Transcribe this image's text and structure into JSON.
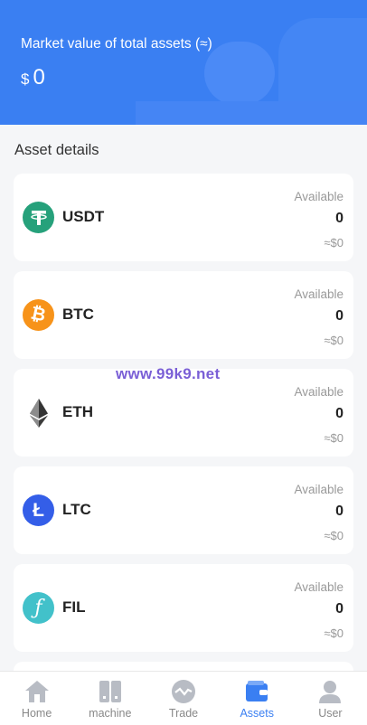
{
  "header": {
    "title": "Market value of total assets (≈)",
    "currency": "$",
    "total": "0"
  },
  "section_title": "Asset details",
  "assets": [
    {
      "symbol": "USDT",
      "available_label": "Available",
      "available": "0",
      "approx": "≈$0",
      "icon": "usdt-icon",
      "color": "#26a17b",
      "glyph": "₮"
    },
    {
      "symbol": "BTC",
      "available_label": "Available",
      "available": "0",
      "approx": "≈$0",
      "icon": "btc-icon",
      "color": "#f7931a",
      "glyph": "₿"
    },
    {
      "symbol": "ETH",
      "available_label": "Available",
      "available": "0",
      "approx": "≈$0",
      "icon": "eth-icon",
      "color": "#ffffff",
      "glyph": ""
    },
    {
      "symbol": "LTC",
      "available_label": "Available",
      "available": "0",
      "approx": "≈$0",
      "icon": "ltc-icon",
      "color": "#345ee8",
      "glyph": "Ł"
    },
    {
      "symbol": "FIL",
      "available_label": "Available",
      "available": "0",
      "approx": "≈$0",
      "icon": "fil-icon",
      "color": "#42c1ca",
      "glyph": "ƒ"
    }
  ],
  "watermark": "www.99k9.net",
  "tabbar": {
    "items": [
      {
        "label": "Home",
        "icon": "home-icon"
      },
      {
        "label": "machine",
        "icon": "machine-icon"
      },
      {
        "label": "Trade",
        "icon": "trade-icon"
      },
      {
        "label": "Assets",
        "icon": "wallet-icon",
        "active": true
      },
      {
        "label": "User",
        "icon": "user-icon"
      }
    ]
  },
  "colors": {
    "accent": "#3a7ff2",
    "inactive": "#888888"
  }
}
